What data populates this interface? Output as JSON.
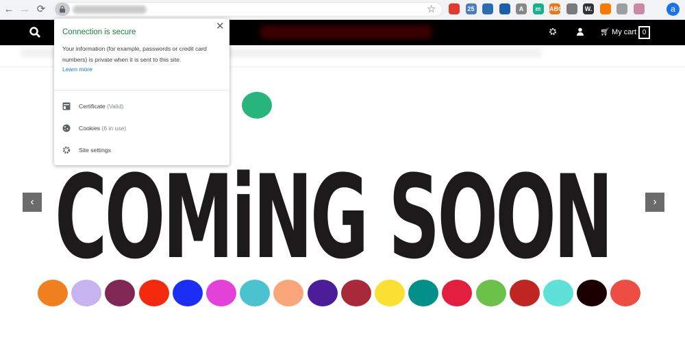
{
  "browser": {
    "nav": {
      "back": "←",
      "forward": "→",
      "reload": "⟳"
    },
    "star_icon": "☆",
    "extensions": [
      {
        "name": "opera-ext",
        "color": "#e23b2e",
        "label": ""
      },
      {
        "name": "mail-ext",
        "color": "#4a7dbd",
        "label": "25"
      },
      {
        "name": "bookmark-ext",
        "color": "#2b6cb0",
        "label": ""
      },
      {
        "name": "blue-circle-ext",
        "color": "#1b5fa6",
        "label": ""
      },
      {
        "name": "font-ext",
        "color": "#888888",
        "label": "A"
      },
      {
        "name": "m-ext",
        "color": "#16b28a",
        "label": "m"
      },
      {
        "name": "abc-ext",
        "color": "#e8761b",
        "label": "ABC"
      },
      {
        "name": "image-ext",
        "color": "#7a7a7a",
        "label": ""
      },
      {
        "name": "w-ext",
        "color": "#333333",
        "label": "W."
      },
      {
        "name": "orange-ext",
        "color": "#f57c00",
        "label": ""
      },
      {
        "name": "puzzle-ext",
        "color": "#9e9e9e",
        "label": ""
      },
      {
        "name": "bug-ext",
        "color": "#c98aa6",
        "label": ""
      }
    ],
    "avatar_letter": "a"
  },
  "site": {
    "cart_label": "My cart",
    "cart_count": "0"
  },
  "hero": {
    "headline": "COMiNG SOON",
    "prev_arrow": "‹",
    "next_arrow": "›",
    "top_dot_color": "#27b57c",
    "dot_colors": [
      "#f0801f",
      "#c7b3f0",
      "#7f2856",
      "#f5290e",
      "#1c2ef5",
      "#e441d8",
      "#4bc2d0",
      "#fba57a",
      "#4c1d98",
      "#a7293a",
      "#f9e033",
      "#009089",
      "#e21f3e",
      "#6cc14a",
      "#bf2623",
      "#5ee1d8",
      "#1a0000",
      "#ee4d43"
    ]
  },
  "popup": {
    "close": "✕",
    "title": "Connection is secure",
    "description": "Your information (for example, passwords or credit card numbers) is private when it is sent to this site.",
    "learn_more": "Learn more",
    "items": [
      {
        "label": "Certificate",
        "detail": "(Valid)"
      },
      {
        "label": "Cookies",
        "detail": "(6 in use)"
      },
      {
        "label": "Site settings",
        "detail": ""
      }
    ]
  }
}
